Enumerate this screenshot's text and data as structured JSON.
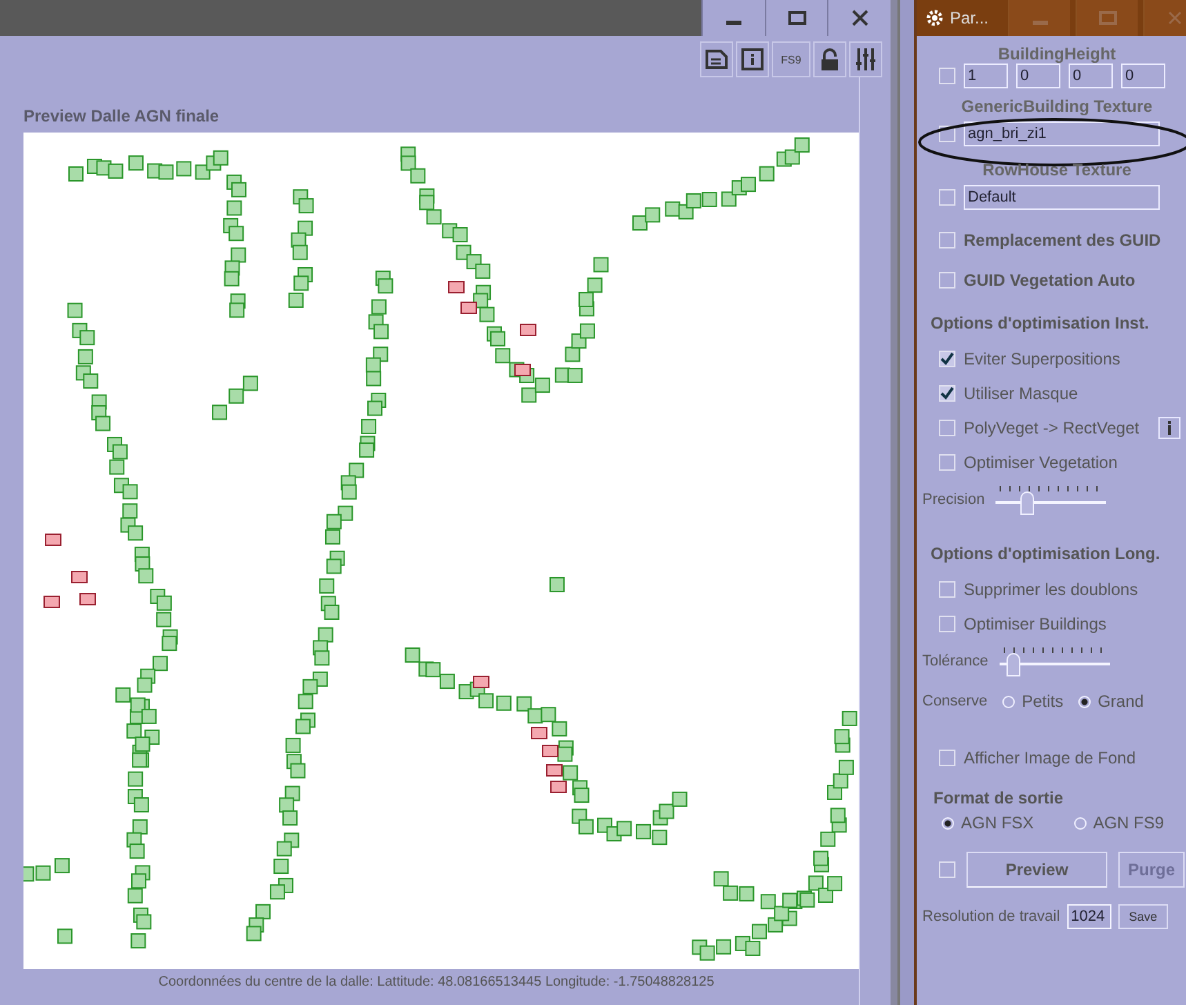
{
  "main_window": {
    "toolbar_label": "FS9",
    "preview_title": "Preview Dalle AGN finale",
    "status": "Coordonnées du centre de la dalle: Lattitude: 48.08166513445   Longitude: -1.75048828125"
  },
  "panel": {
    "title": "Par...",
    "building_height": {
      "label": "BuildingHeight",
      "checked": false,
      "values": [
        "1",
        "0",
        "0",
        "0"
      ]
    },
    "texture_fields": [
      {
        "label": "GenericBuilding Texture",
        "checked": false,
        "value": "agn_bri_zi1",
        "highlighted": true
      },
      {
        "label": "RowHouse Texture",
        "checked": false,
        "value": "Default",
        "highlighted": false
      }
    ],
    "options": [
      {
        "label": "Remplacement des GUID",
        "checked": false
      },
      {
        "label": "GUID Vegetation Auto",
        "checked": false
      }
    ],
    "sections": [
      {
        "heading": "Options d'optimisation Inst.",
        "items": [
          {
            "kind": "checkbox",
            "label": "Eviter Superpositions",
            "checked": true
          },
          {
            "kind": "checkbox",
            "label": "Utiliser Masque",
            "checked": true
          },
          {
            "kind": "checkbox_info",
            "label": "PolyVeget -> RectVeget",
            "checked": false
          },
          {
            "kind": "checkbox",
            "label": "Optimiser Vegetation",
            "checked": false
          },
          {
            "kind": "slider",
            "label": "Precision",
            "level": 0.25
          }
        ]
      },
      {
        "heading": "Options d'optimisation Long.",
        "items": [
          {
            "kind": "checkbox",
            "label": "Supprimer les doublons",
            "checked": false
          },
          {
            "kind": "checkbox",
            "label": "Optimiser Buildings",
            "checked": false
          },
          {
            "kind": "slider",
            "label": "Tolérance",
            "level": 0.08
          },
          {
            "kind": "radio",
            "label": "Conserve",
            "options": [
              {
                "label": "Petits",
                "selected": false
              },
              {
                "label": "Grand",
                "selected": true
              }
            ]
          }
        ]
      }
    ],
    "background_image": {
      "label": "Afficher Image de Fond",
      "checked": false
    },
    "output_format": {
      "heading": "Format de sortie",
      "options": [
        {
          "label": "AGN FSX",
          "selected": true
        },
        {
          "label": "AGN FS9",
          "selected": false
        }
      ]
    },
    "preview_checked": false,
    "preview_button": "Preview",
    "purge_button": {
      "label": "Purge",
      "disabled": true
    },
    "resolution": {
      "label": "Resolution de travail",
      "value": "1024"
    },
    "save_button": "Save"
  }
}
